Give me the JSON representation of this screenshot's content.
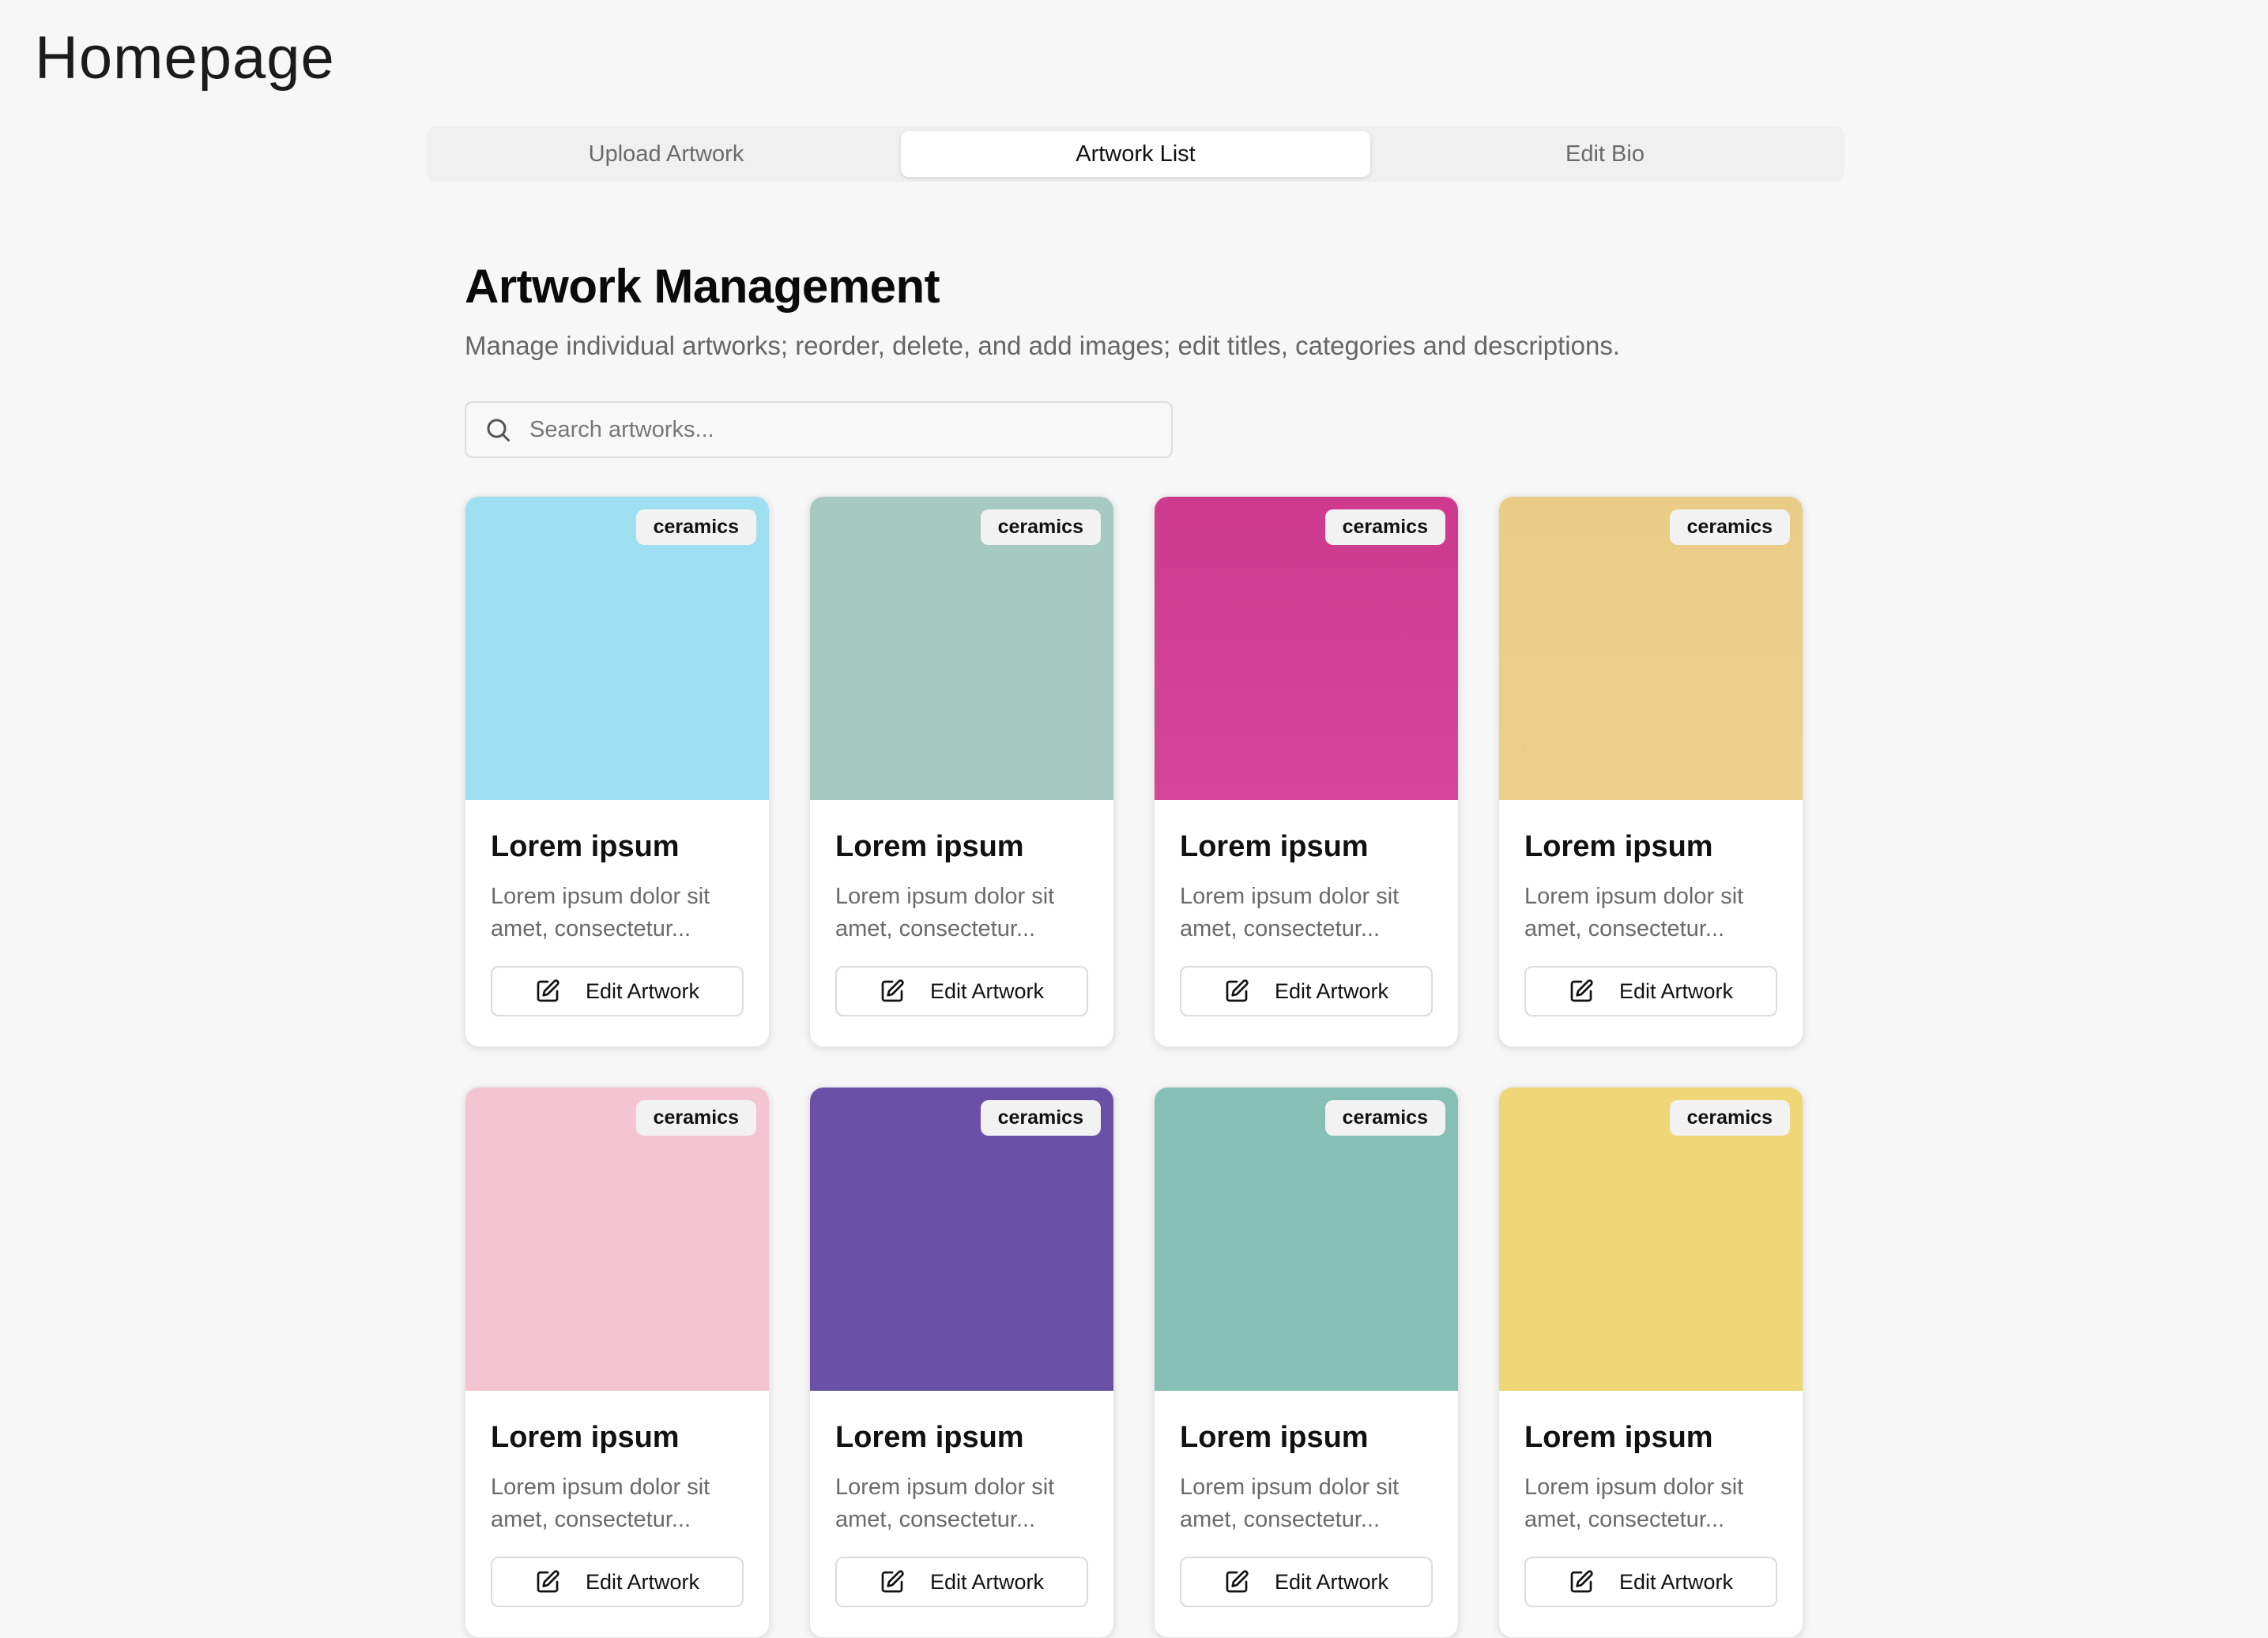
{
  "header": {
    "title": "Homepage"
  },
  "tabs": [
    {
      "label": "Upload Artwork",
      "active": false
    },
    {
      "label": "Artwork List",
      "active": true
    },
    {
      "label": "Edit Bio",
      "active": false
    }
  ],
  "main": {
    "title": "Artwork Management",
    "subtitle": "Manage individual artworks; reorder, delete, and add images; edit titles, categories and descriptions.",
    "search": {
      "placeholder": "Search artworks...",
      "value": "",
      "icon": "search-icon"
    }
  },
  "artworks": [
    {
      "category": "ceramics",
      "title": "Lorem ipsum",
      "description": "Lorem ipsum dolor sit amet, consectetur...",
      "edit_label": "Edit Artwork",
      "color": "#9ee0f1",
      "color2": "#9ee0f1"
    },
    {
      "category": "ceramics",
      "title": "Lorem ipsum",
      "description": "Lorem ipsum dolor sit amet, consectetur...",
      "edit_label": "Edit Artwork",
      "color": "#a6cac1",
      "color2": "#a6cac1"
    },
    {
      "category": "ceramics",
      "title": "Lorem ipsum",
      "description": "Lorem ipsum dolor sit amet, consectetur...",
      "edit_label": "Edit Artwork",
      "color": "#cd3a8e",
      "color2": "#d4469a"
    },
    {
      "category": "ceramics",
      "title": "Lorem ipsum",
      "description": "Lorem ipsum dolor sit amet, consectetur...",
      "edit_label": "Edit Artwork",
      "color": "#e9cd86",
      "color2": "#eccf8b"
    },
    {
      "category": "ceramics",
      "title": "Lorem ipsum",
      "description": "Lorem ipsum dolor sit amet, consectetur...",
      "edit_label": "Edit Artwork",
      "color": "#f5c4d2",
      "color2": "#f5c4d2"
    },
    {
      "category": "ceramics",
      "title": "Lorem ipsum",
      "description": "Lorem ipsum dolor sit amet, consectetur...",
      "edit_label": "Edit Artwork",
      "color": "#6b50a8",
      "color2": "#6b50a8"
    },
    {
      "category": "ceramics",
      "title": "Lorem ipsum",
      "description": "Lorem ipsum dolor sit amet, consectetur...",
      "edit_label": "Edit Artwork",
      "color": "#86c0b4",
      "color2": "#86c0b4"
    },
    {
      "category": "ceramics",
      "title": "Lorem ipsum",
      "description": "Lorem ipsum dolor sit amet, consectetur...",
      "edit_label": "Edit Artwork",
      "color": "#efd677",
      "color2": "#efd677"
    }
  ],
  "icons": {
    "edit": "edit-icon",
    "search": "search-icon"
  }
}
